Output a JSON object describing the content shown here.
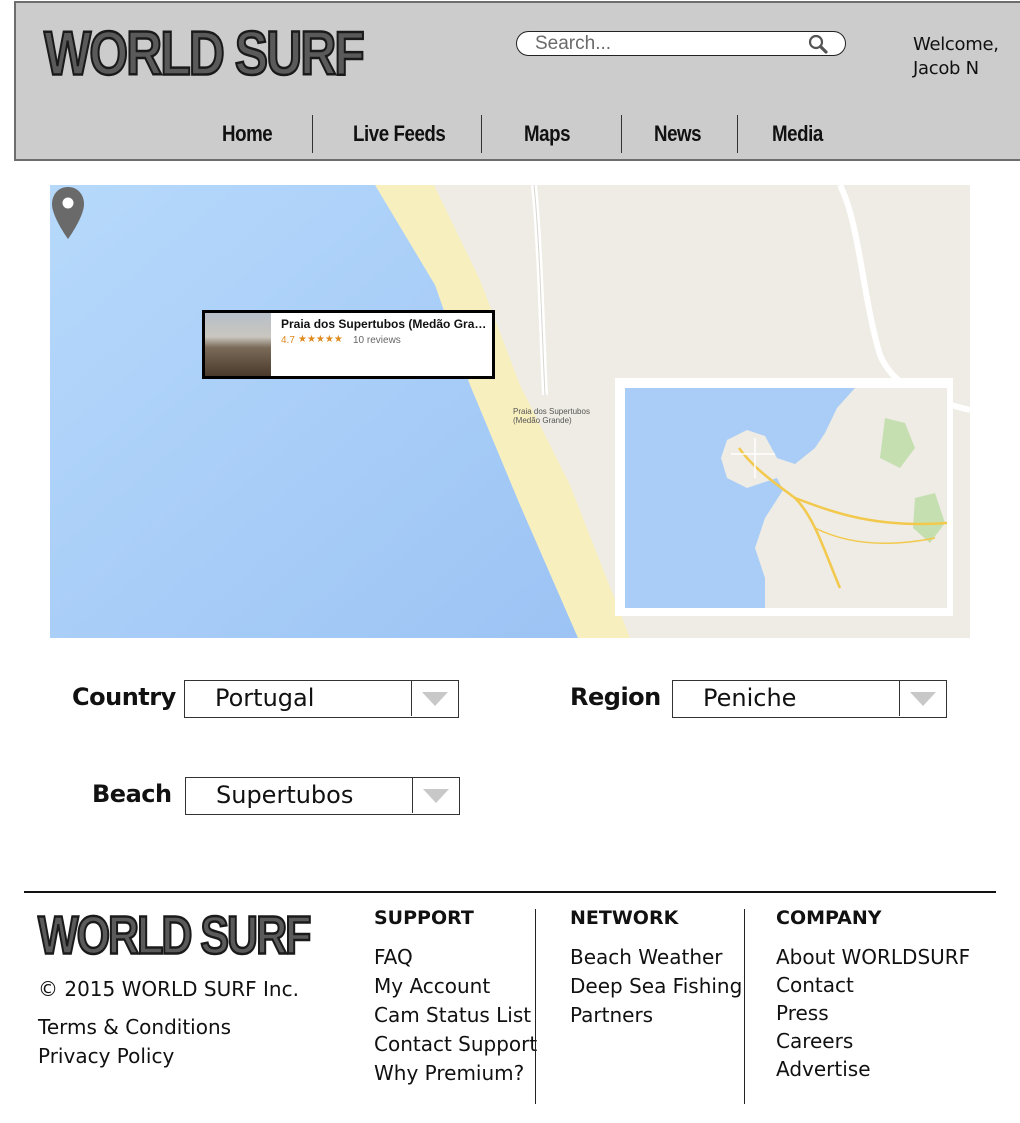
{
  "header": {
    "logo": "WORLD SURF",
    "search_placeholder": "Search...",
    "welcome_line1": "Welcome,",
    "welcome_line2": "Jacob N"
  },
  "nav": [
    {
      "label": "Home"
    },
    {
      "label": "Live Feeds"
    },
    {
      "label": "Maps"
    },
    {
      "label": "News"
    },
    {
      "label": "Media"
    }
  ],
  "map": {
    "popup": {
      "name": "Praia dos Supertubos (Medão Grande)",
      "rating": "4.7",
      "stars": "★★★★★",
      "reviews": "10 reviews"
    },
    "pin_label_line1": "Praia dos Supertubos",
    "pin_label_line2": "(Medão Grande)",
    "colors": {
      "sea": "#a9cdf6",
      "sand": "#f8efbe",
      "land": "#eeece4"
    }
  },
  "filters": {
    "country": {
      "label": "Country",
      "value": "Portugal"
    },
    "region": {
      "label": "Region",
      "value": "Peniche"
    },
    "beach": {
      "label": "Beach",
      "value": "Supertubos"
    }
  },
  "footer": {
    "logo": "WORLD SURF",
    "copyright": "© 2015 WORLD SURF Inc.",
    "terms": "Terms & Conditions",
    "privacy": "Privacy Policy",
    "support": {
      "heading": "SUPPORT",
      "links": [
        "FAQ",
        "My Account",
        "Cam Status List",
        "Contact Support",
        "Why Premium?"
      ]
    },
    "network": {
      "heading": "NETWORK",
      "links": [
        "Beach Weather",
        "Deep Sea Fishing",
        "Partners"
      ]
    },
    "company": {
      "heading": "COMPANY",
      "links": [
        "About WORLDSURF",
        "Contact",
        "Press",
        "Careers",
        "Advertise"
      ]
    }
  }
}
